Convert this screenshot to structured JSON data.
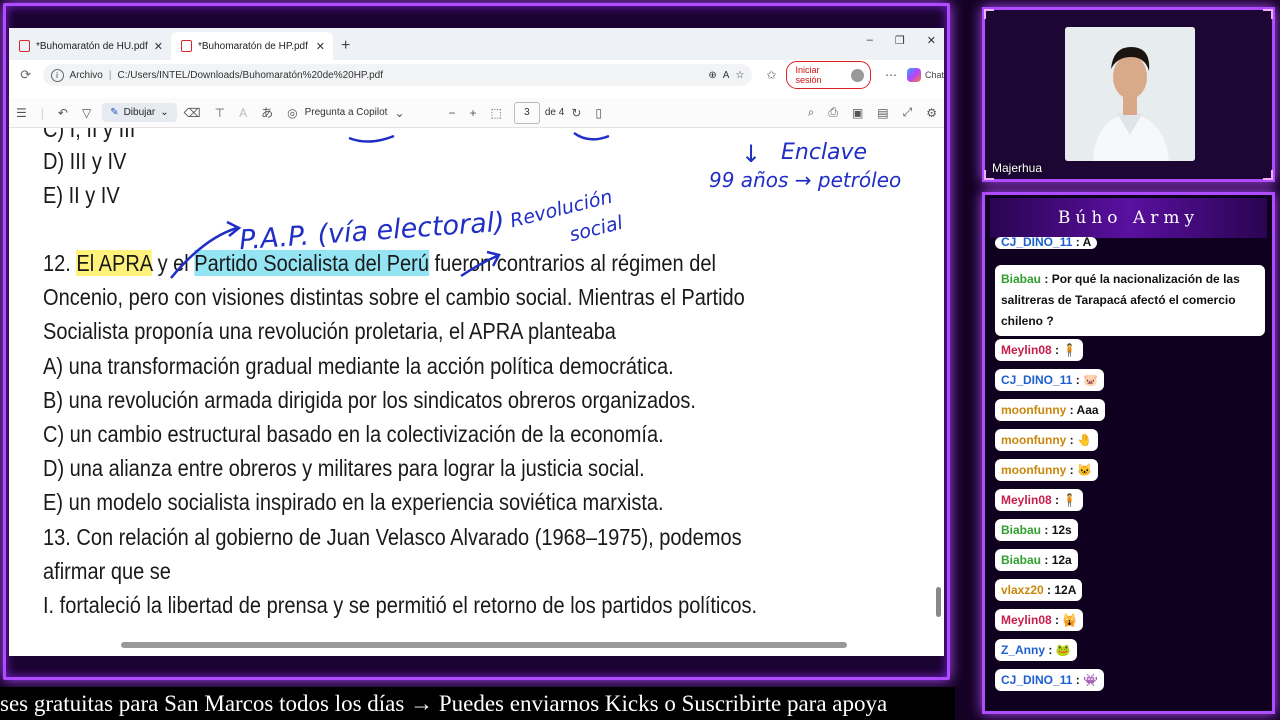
{
  "browser": {
    "tabs": [
      {
        "label": "*Buhomaratón de HU.pdf",
        "active": false
      },
      {
        "label": "*Buhomaratón de HP.pdf",
        "active": true
      }
    ],
    "new_tab": "+",
    "window_controls": [
      "–",
      "❐",
      "✕"
    ],
    "address": {
      "scheme_label": "Archivo",
      "url": "C:/Users/INTEL/Downloads/Buhomaratón%20de%20HP.pdf",
      "signin_label": "Iniciar sesión",
      "copilot_label": "Chat"
    }
  },
  "pdf_toolbar": {
    "draw_label": "Dibujar",
    "copilot_label": "Pregunta a Copilot",
    "page_current": "3",
    "page_total": "de 4"
  },
  "document": {
    "lines": {
      "partial_top": "C) I, II y III",
      "opt_d_prev": "D) III y IV",
      "opt_e_prev": "E) II y IV",
      "q12_num": "12.",
      "q12_apra": "El APRA",
      "q12_y": "y el",
      "q12_ps": "Partido Socialista del Perú",
      "q12_rest": "fueron contrarios al régimen del",
      "q12_l2": "Oncenio, pero con visiones distintas sobre el cambio social. Mientras el Partido",
      "q12_l3": "Socialista proponía una revolución proletaria, el APRA planteaba",
      "q12_a": "A) una transformación gradual mediante la acción política democrática.",
      "q12_b": "B) una revolución armada dirigida por los sindicatos obreros organizados.",
      "q12_c": "C) un cambio estructural basado en la colectivización de la economía.",
      "q12_d": "D) una alianza entre obreros y militares para lograr la justicia social.",
      "q12_e": "E) un modelo socialista inspirado en la experiencia soviética marxista.",
      "q13_l1": "13. Con relación al gobierno de Juan Velasco Alvarado (1968–1975), podemos",
      "q13_l2": "afirmar que se",
      "q13_i": "I. fortaleció la libertad de prensa y se permitió el retorno de los partidos políticos."
    },
    "handwriting": {
      "pap": "P.A.P. (vía electoral)",
      "revolucion": "Revolución",
      "social": "social",
      "enclave": "Enclave",
      "anos": "99 años → petróleo",
      "arrow_down": "↓"
    }
  },
  "webcam": {
    "name": "Majerhua"
  },
  "chat": {
    "title": "Búho Army",
    "messages": [
      {
        "user": "CJ_DINO_11",
        "text": "A",
        "color": "#1e5fd0"
      },
      {
        "user": "Biabau",
        "text": "Por qué la nacionalización de las salitreras de Tarapacá afectó el comercio chileno ?",
        "color": "#2f9e2f"
      },
      {
        "user": "Meylin08",
        "text": "",
        "emote": "🧍",
        "color": "#c41e4a"
      },
      {
        "user": "CJ_DINO_11",
        "text": "",
        "emote": "🐷",
        "color": "#1e5fd0"
      },
      {
        "user": "moonfunny",
        "text": "Aaa",
        "color": "#c9870c"
      },
      {
        "user": "moonfunny",
        "text": "",
        "emote": "🤚",
        "color": "#c9870c"
      },
      {
        "user": "moonfunny",
        "text": "",
        "emote": "🐱",
        "color": "#c9870c"
      },
      {
        "user": "Meylin08",
        "text": "",
        "emote": "🧍",
        "color": "#c41e4a"
      },
      {
        "user": "Biabau",
        "text": "12s",
        "color": "#2f9e2f"
      },
      {
        "user": "Biabau",
        "text": "12a",
        "color": "#2f9e2f"
      },
      {
        "user": "vlaxz20",
        "text": "12A",
        "color": "#c9870c"
      },
      {
        "user": "Meylin08",
        "text": "",
        "emote": "🙀",
        "color": "#c41e4a"
      },
      {
        "user": "Z_Anny",
        "text": "",
        "emote": "🐸",
        "color": "#1e5fd0"
      },
      {
        "user": "CJ_DINO_11",
        "text": "",
        "emote": "👾",
        "color": "#1e5fd0"
      }
    ]
  },
  "ticker": {
    "text": "ses gratuitas para San Marcos todos los días  →  Puedes enviarnos Kicks o Suscribirte para apoya"
  }
}
